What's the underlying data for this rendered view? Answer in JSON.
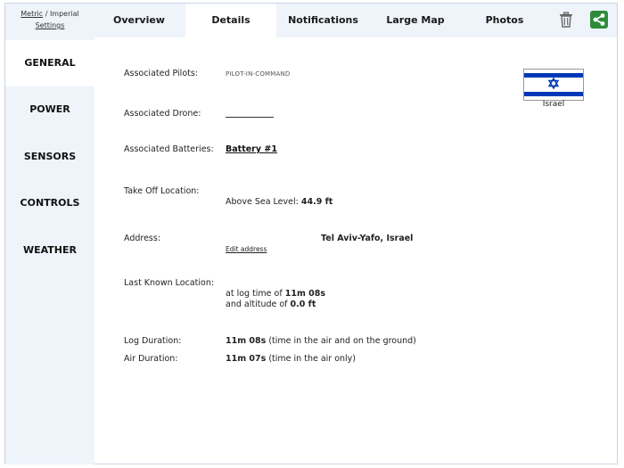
{
  "units": {
    "metric": "Metric",
    "separator": "/",
    "imperial": "Imperial",
    "settings": "Settings"
  },
  "tabs": [
    {
      "label": "Overview"
    },
    {
      "label": "Details"
    },
    {
      "label": "Notifications"
    },
    {
      "label": "Large Map"
    },
    {
      "label": "Photos"
    }
  ],
  "active_tab": "Details",
  "sidebar": {
    "items": [
      {
        "label": "GENERAL"
      },
      {
        "label": "POWER"
      },
      {
        "label": "SENSORS"
      },
      {
        "label": "CONTROLS"
      },
      {
        "label": "WEATHER"
      }
    ],
    "active": "GENERAL"
  },
  "details": {
    "pilots_label": "Associated Pilots:",
    "pilots_value": "PILOT-IN-COMMAND",
    "drone_label": "Associated Drone:",
    "batteries_label": "Associated Batteries:",
    "batteries_value": "Battery #1",
    "takeoff_label": "Take Off Location:",
    "takeoff_asl_prefix": "Above Sea Level:",
    "takeoff_asl_value": "44.9 ft",
    "address_label": "Address:",
    "address_value": "Tel Aviv-Yafo, Israel",
    "edit_address": "Edit address",
    "last_known_label": "Last Known Location:",
    "log_time_prefix": "at log time of",
    "log_time_value": "11m 08s",
    "altitude_prefix": "and altitude of",
    "altitude_value": "0.0 ft",
    "log_duration_label": "Log Duration:",
    "log_duration_value": "11m 08s",
    "log_duration_note": "(time in the air and on the ground)",
    "air_duration_label": "Air Duration:",
    "air_duration_value": "11m 07s",
    "air_duration_note": "(time in the air only)"
  },
  "country": {
    "name": "Israel"
  },
  "colors": {
    "accent_blue": "#0038b8",
    "share_green": "#2e8b3a",
    "panel_bg": "#eef4fa"
  },
  "icons": [
    "trash-icon",
    "share-icon"
  ]
}
